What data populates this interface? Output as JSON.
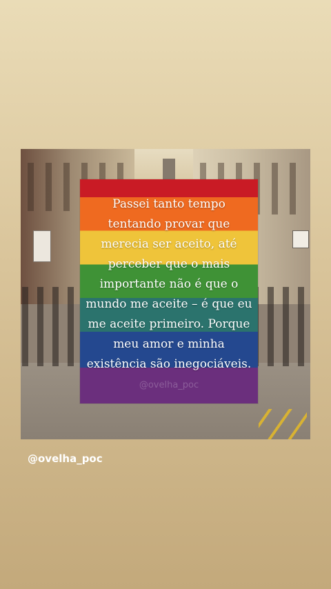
{
  "post": {
    "quote": "Passei tanto tempo\ntentando provar que\nmerecia ser aceito, até\nperceber que o mais\nimportante não é que o\nmundo me aceite – é que eu\nme aceite primeiro. Porque\nmeu amor e minha\nexistência são inegociáveis.",
    "watermark": "@ovelha_poc"
  },
  "mention": {
    "label": "@ovelha_poc"
  },
  "background": {
    "top_color": "#eadcb7",
    "bottom_color": "#c3a97b"
  },
  "rainbow_colors": [
    "#c91b25",
    "#ef6a20",
    "#efc43a",
    "#3f9236",
    "#2b736d",
    "#24488f",
    "#6b2f7d"
  ]
}
